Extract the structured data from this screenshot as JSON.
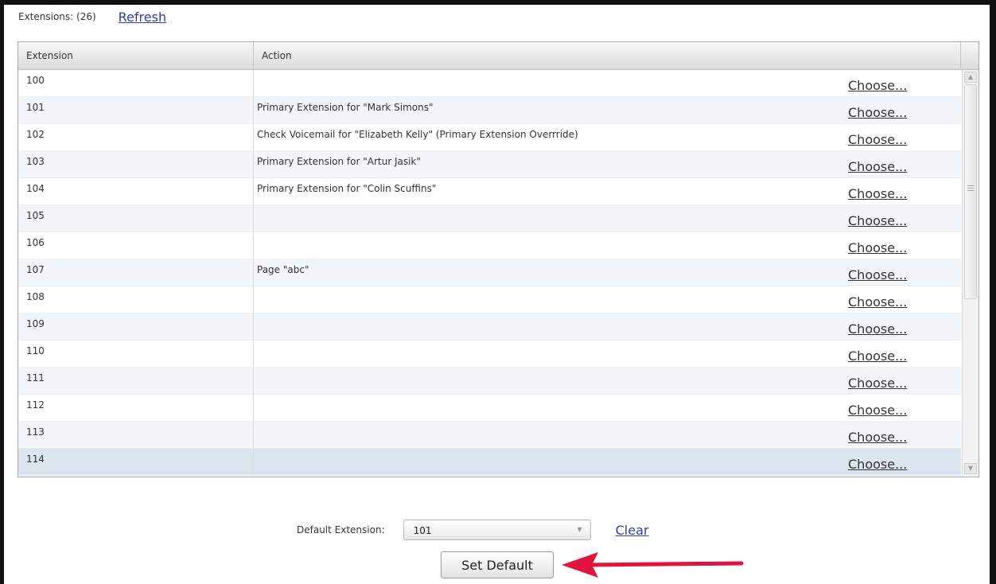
{
  "header": {
    "extensions_count": "Extensions: (26)",
    "refresh_label": "Refresh"
  },
  "table": {
    "columns": [
      "Extension",
      "Action"
    ],
    "choose_label": "Choose...",
    "rows": [
      {
        "extension": "100",
        "action": ""
      },
      {
        "extension": "101",
        "action": "Primary Extension for \"Mark Simons\""
      },
      {
        "extension": "102",
        "action": "Check Voicemail for \"Elizabeth Kelly\" (Primary Extension Overrride)"
      },
      {
        "extension": "103",
        "action": "Primary Extension for \"Artur Jasik\""
      },
      {
        "extension": "104",
        "action": "Primary Extension for \"Colin Scuffins\""
      },
      {
        "extension": "105",
        "action": ""
      },
      {
        "extension": "106",
        "action": ""
      },
      {
        "extension": "107",
        "action": "Page \"abc\""
      },
      {
        "extension": "108",
        "action": ""
      },
      {
        "extension": "109",
        "action": ""
      },
      {
        "extension": "110",
        "action": ""
      },
      {
        "extension": "111",
        "action": ""
      },
      {
        "extension": "112",
        "action": ""
      },
      {
        "extension": "113",
        "action": ""
      },
      {
        "extension": "114",
        "action": ""
      }
    ]
  },
  "default_extension": {
    "label": "Default Extension:",
    "selected": "101",
    "clear_label": "Clear",
    "set_default_label": "Set Default"
  },
  "colors": {
    "annotation_arrow": "#e0143c",
    "link": "#2b3fa0",
    "selected_row": "#dbe4ef"
  }
}
